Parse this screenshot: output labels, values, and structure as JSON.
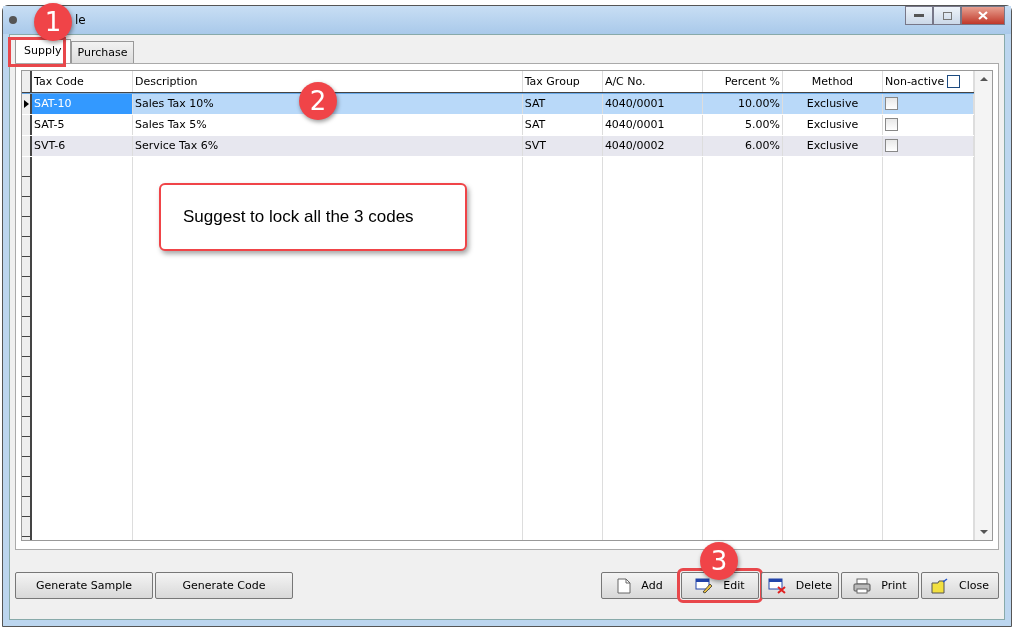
{
  "window": {
    "title": "le"
  },
  "tabs": [
    {
      "label": "Supply",
      "selected": true
    },
    {
      "label": "Purchase",
      "selected": false
    }
  ],
  "table": {
    "columns": [
      "Tax Code",
      "Description",
      "Tax Group",
      "A/C No.",
      "Percent %",
      "Method",
      "Non-active"
    ],
    "header_checked": false,
    "rows": [
      {
        "selected": true,
        "cells": [
          "SAT-10",
          "Sales Tax 10%",
          "SAT",
          "4040/0001",
          "10.00%",
          "Exclusive"
        ],
        "non_active": false
      },
      {
        "selected": false,
        "cells": [
          "SAT-5",
          "Sales Tax 5%",
          "SAT",
          "4040/0001",
          "5.00%",
          "Exclusive"
        ],
        "non_active": false
      },
      {
        "selected": false,
        "cells": [
          "SVT-6",
          "Service Tax 6%",
          "SVT",
          "4040/0002",
          "6.00%",
          "Exclusive"
        ],
        "non_active": false
      }
    ]
  },
  "buttons_left": [
    {
      "label": "Generate Sample"
    },
    {
      "label": "Generate Code"
    }
  ],
  "buttons_right": [
    {
      "label": "Add",
      "kind": "add"
    },
    {
      "label": "Edit",
      "kind": "edit"
    },
    {
      "label": "Delete",
      "kind": "delete"
    },
    {
      "label": "Print",
      "kind": "print"
    },
    {
      "label": "Close",
      "kind": "close"
    }
  ],
  "annotations": {
    "badges": [
      "1",
      "2",
      "3"
    ],
    "note": "Suggest to lock all the 3 codes"
  }
}
